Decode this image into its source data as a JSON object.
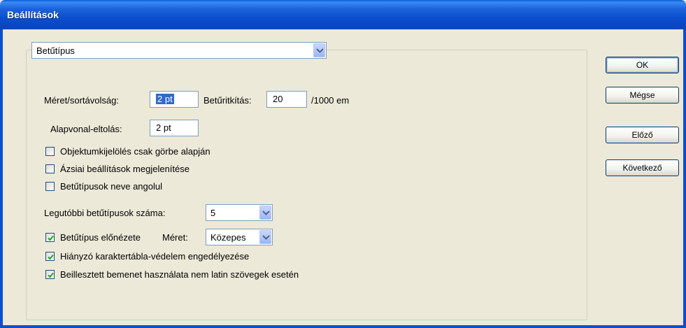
{
  "window": {
    "title": "Beállítások"
  },
  "panel_select": {
    "value": "Betűtípus",
    "icon": "chevron-down-icon"
  },
  "size_leading": {
    "label": "Méret/sortávolság:",
    "value": "2 pt"
  },
  "tracking": {
    "label": "Betűritkítás:",
    "value": "20",
    "unit": "/1000 em"
  },
  "baseline_shift": {
    "label": "Alapvonal-eltolás:",
    "value": "2 pt"
  },
  "checkboxes": [
    {
      "label": "Objektumkijelölés csak görbe alapján",
      "checked": false
    },
    {
      "label": "Ázsiai beállítások megjelenítése",
      "checked": false
    },
    {
      "label": "Betűtípusok neve angolul",
      "checked": false
    }
  ],
  "recent_fonts": {
    "label": "Legutóbbi betűtípusok száma:",
    "value": "5"
  },
  "font_preview": {
    "label": "Betűtípus előnézete",
    "size_label": "Méret:",
    "size_value": "Közepes",
    "checked": true
  },
  "checkboxes2": [
    {
      "label": "Hiányzó karaktertábla-védelem engedélyezése",
      "checked": true
    },
    {
      "label": "Beillesztett bemenet használata nem latin szövegek esetén",
      "checked": true
    }
  ],
  "buttons": {
    "ok": "OK",
    "cancel": "Mégse",
    "prev": "Előző",
    "next": "Következő"
  },
  "colors": {
    "titlebar": "#0b4fcf",
    "dialog_bg": "#ece9d8",
    "selection": "#316ac5",
    "check": "#21a121"
  }
}
